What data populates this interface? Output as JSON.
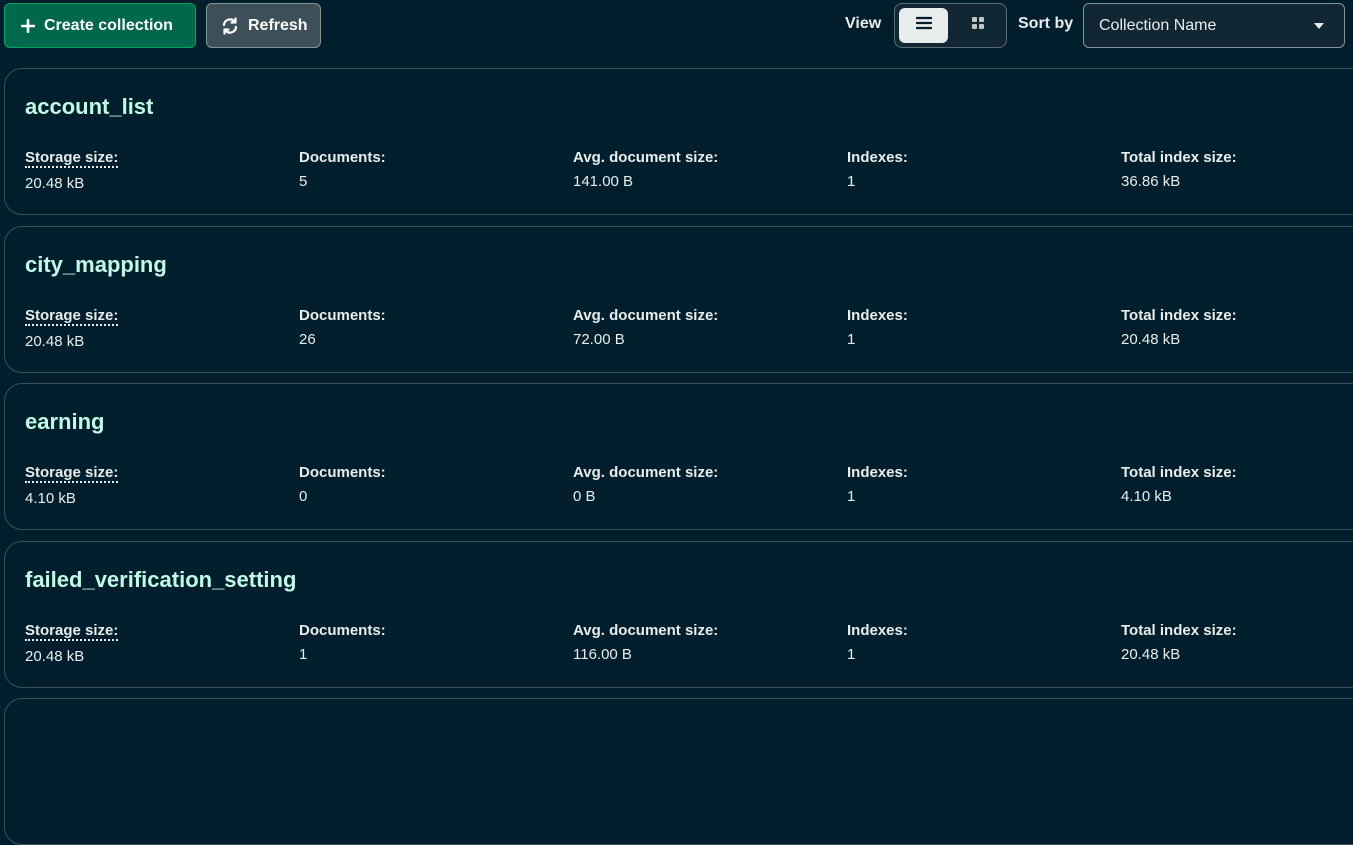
{
  "toolbar": {
    "create_label": "Create collection",
    "refresh_label": "Refresh",
    "view_label": "View",
    "sort_label": "Sort by",
    "sort_value": "Collection Name",
    "active_view": "list"
  },
  "stat_labels": {
    "storage": "Storage size:",
    "documents": "Documents:",
    "avg_size": "Avg. document size:",
    "indexes": "Indexes:",
    "total_index": "Total index size:"
  },
  "collections": [
    {
      "name": "account_list",
      "storage": "20.48 kB",
      "documents": "5",
      "avg_size": "141.00 B",
      "indexes": "1",
      "total_index": "36.86 kB"
    },
    {
      "name": "city_mapping",
      "storage": "20.48 kB",
      "documents": "26",
      "avg_size": "72.00 B",
      "indexes": "1",
      "total_index": "20.48 kB"
    },
    {
      "name": "earning",
      "storage": "4.10 kB",
      "documents": "0",
      "avg_size": "0 B",
      "indexes": "1",
      "total_index": "4.10 kB"
    },
    {
      "name": "failed_verification_setting",
      "storage": "20.48 kB",
      "documents": "1",
      "avg_size": "116.00 B",
      "indexes": "1",
      "total_index": "20.48 kB"
    }
  ],
  "colors": {
    "background": "#001e2b",
    "accent_green": "#00684a",
    "title_mint": "#c0fae6",
    "card_border": "#3d4f58"
  }
}
